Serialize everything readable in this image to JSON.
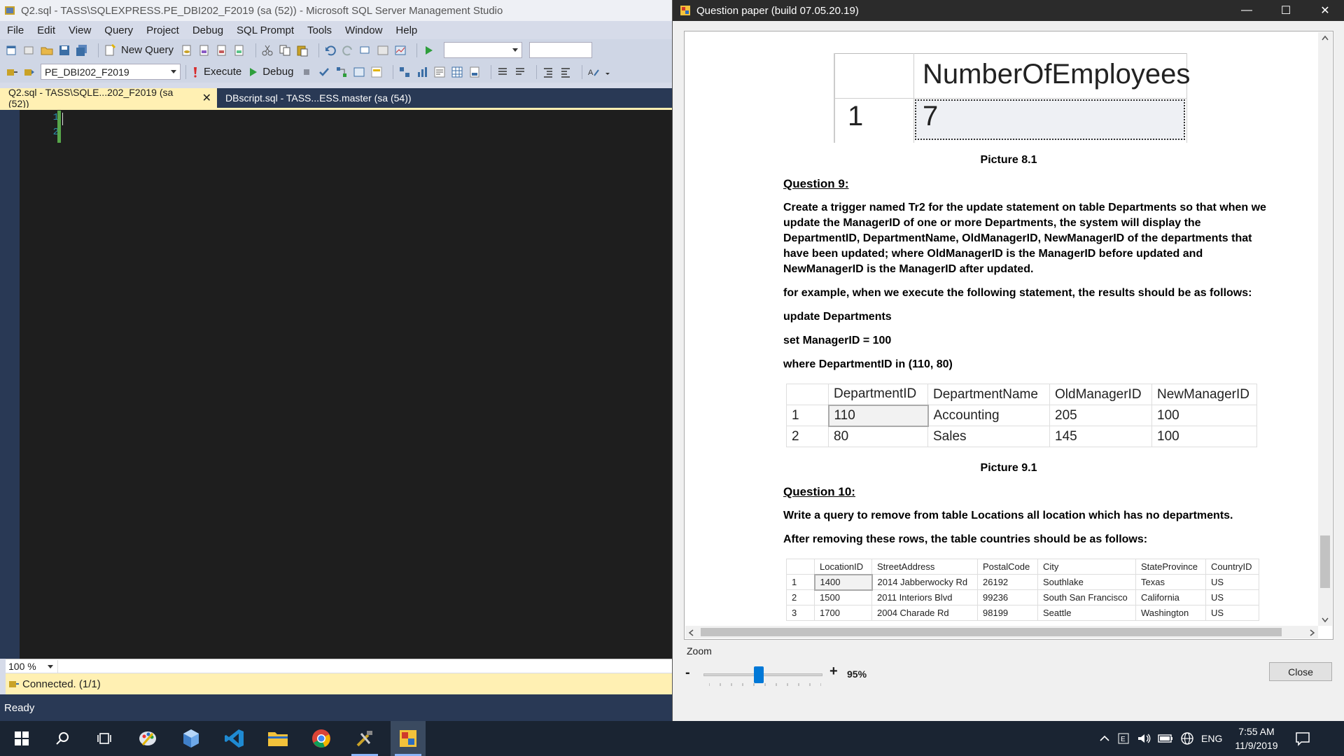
{
  "ssms": {
    "title": "Q2.sql - TASS\\SQLEXPRESS.PE_DBI202_F2019 (sa (52)) - Microsoft SQL Server Management Studio",
    "menu": [
      "File",
      "Edit",
      "View",
      "Query",
      "Project",
      "Debug",
      "SQL Prompt",
      "Tools",
      "Window",
      "Help"
    ],
    "toolbar": {
      "new_query": "New Query",
      "database": "PE_DBI202_F2019",
      "execute": "Execute",
      "debug": "Debug"
    },
    "tabs": [
      {
        "label": "Q2.sql - TASS\\SQLE...202_F2019 (sa (52))",
        "close": "✕"
      },
      {
        "label": "DBscript.sql - TASS...ESS.master (sa (54))"
      }
    ],
    "editor": {
      "lines": [
        "1",
        "2"
      ]
    },
    "zoom": "100 %",
    "status_connected": "Connected. (1/1)",
    "status_ready": "Ready"
  },
  "question_paper": {
    "title": "Question paper (build 07.05.20.19)",
    "window_controls": {
      "minimize": "—",
      "maximize": "☐",
      "close": "✕"
    },
    "picture81": {
      "header": "NumberOfEmployees",
      "row_num": "1",
      "value": "7",
      "caption": "Picture 8.1"
    },
    "q9": {
      "heading": "Question 9:",
      "para1_l1": "Create a trigger named Tr2 for the update statement on table Departments so that when we",
      "para1_l2": "update the ManagerID of one or more Departments, the system will display the",
      "para1_l3": "DepartmentID, DepartmentName, OldManagerID, NewManagerID of the departments that",
      "para1_l4": "have been updated; where OldManagerID is the ManagerID before updated and",
      "para1_l5": "NewManagerID is the ManagerID after updated.",
      "para2": "for example, when we execute the following statement, the results should be as follows:",
      "code1": "update Departments",
      "code2": "set ManagerID = 100",
      "code3": "where DepartmentID in (110, 80)",
      "table": {
        "headers": [
          "DepartmentID",
          "DepartmentName",
          "OldManagerID",
          "NewManagerID"
        ],
        "rows": [
          {
            "n": "1",
            "c": [
              "110",
              "Accounting",
              "205",
              "100"
            ]
          },
          {
            "n": "2",
            "c": [
              "80",
              "Sales",
              "145",
              "100"
            ]
          }
        ]
      },
      "caption": "Picture 9.1"
    },
    "q10": {
      "heading": "Question 10:",
      "para1": "Write a query to remove from table Locations all location which has no departments.",
      "para2": "After removing these rows, the table countries should be as follows:",
      "table": {
        "headers": [
          "LocationID",
          "StreetAddress",
          "PostalCode",
          "City",
          "StateProvince",
          "CountryID"
        ],
        "rows": [
          {
            "n": "1",
            "c": [
              "1400",
              "2014 Jabberwocky Rd",
              "26192",
              "Southlake",
              "Texas",
              "US"
            ]
          },
          {
            "n": "2",
            "c": [
              "1500",
              "2011 Interiors Blvd",
              "99236",
              "South San Francisco",
              "California",
              "US"
            ]
          },
          {
            "n": "3",
            "c": [
              "1700",
              "2004 Charade Rd",
              "98199",
              "Seattle",
              "Washington",
              "US"
            ]
          }
        ]
      }
    },
    "zoom": {
      "label": "Zoom",
      "minus": "-",
      "plus": "+",
      "value": "95%",
      "level_percent": 95
    },
    "close_button": "Close"
  },
  "taskbar": {
    "tray": {
      "language": "ENG",
      "time": "7:55 AM",
      "date": "11/9/2019"
    }
  },
  "colors": {
    "ssms_chrome": "#d6dbe9",
    "ssms_dark": "#293955",
    "tab_active": "#fff0b3",
    "editor_bg": "#1e1e1e",
    "line_number": "#2b91af",
    "change_bar": "#57a64a",
    "slider_accent": "#0078d7",
    "taskbar": "#1a2432"
  }
}
